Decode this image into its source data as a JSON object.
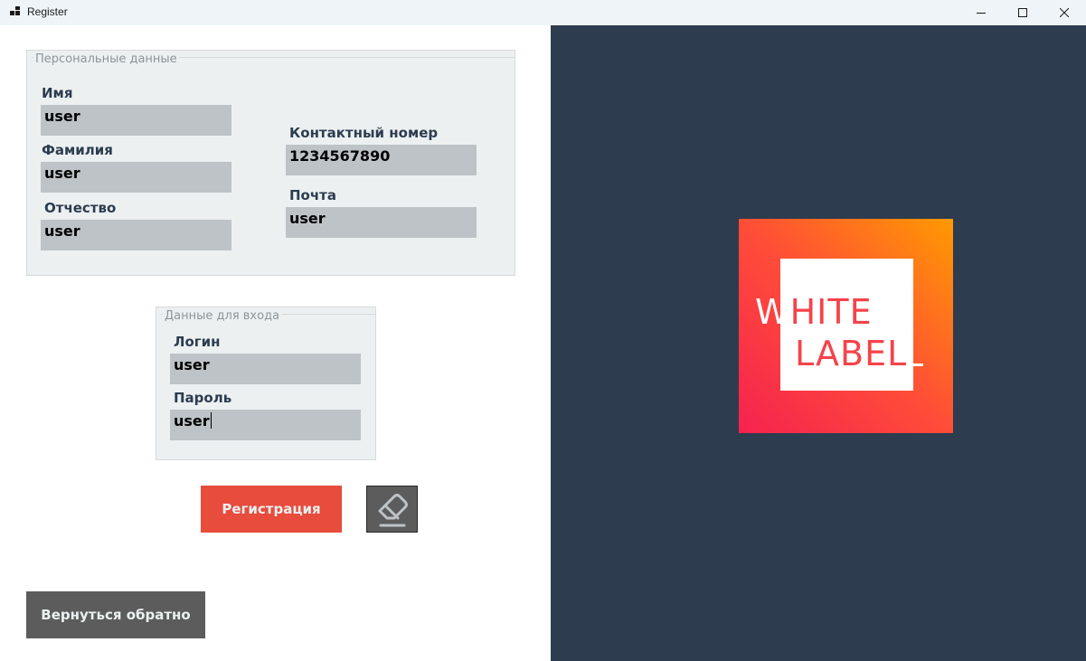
{
  "window": {
    "title": "Register"
  },
  "personal": {
    "legend": "Персональные данные",
    "first_name": {
      "label": "Имя",
      "value": "user"
    },
    "last_name": {
      "label": "Фамилия",
      "value": "user"
    },
    "patronymic": {
      "label": "Отчество",
      "value": "user"
    },
    "phone": {
      "label": "Контактный номер",
      "value": "1234567890"
    },
    "email": {
      "label": "Почта",
      "value": "user"
    }
  },
  "login_data": {
    "legend": "Данные для входа",
    "login": {
      "label": "Логин",
      "value": "user"
    },
    "password": {
      "label": "Пароль",
      "value": "user"
    }
  },
  "buttons": {
    "register": "Регистрация",
    "clear_icon": "eraser-icon",
    "back": "Вернуться обратно"
  },
  "logo": {
    "line1_first": "W",
    "line1_rest": "HITE",
    "line2": "LABEL"
  },
  "colors": {
    "accent": "#e74c3c",
    "panel": "#2d3c4f",
    "field": "#bdc3c7",
    "group": "#ecf0f1",
    "button_dark": "#5c5c5c"
  }
}
